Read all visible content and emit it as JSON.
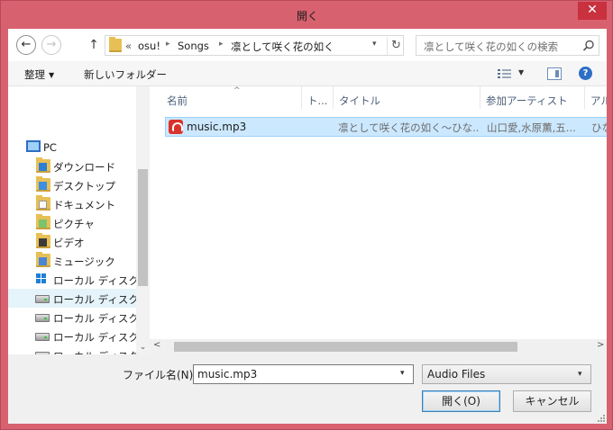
{
  "window": {
    "title": "開く",
    "close_glyph": "✕"
  },
  "address": {
    "back_glyph": "←",
    "forward_glyph": "→",
    "up_glyph": "↑",
    "prefix": "«",
    "segments": [
      "osu!",
      "Songs",
      "凛として咲く花の如く"
    ],
    "separator": "▸",
    "dropdown_glyph": "▾",
    "refresh_glyph": "↻"
  },
  "search": {
    "placeholder": "凛として咲く花の如くの検索",
    "icon": "search-icon"
  },
  "toolbar": {
    "organize_label": "整理",
    "new_folder_label": "新しいフォルダー",
    "caret": "▼"
  },
  "nav": {
    "items": [
      {
        "label": "PC",
        "icon": "pc-icon"
      },
      {
        "label": "ダウンロード",
        "icon": "downloads-folder-icon"
      },
      {
        "label": "デスクトップ",
        "icon": "desktop-folder-icon"
      },
      {
        "label": "ドキュメント",
        "icon": "documents-folder-icon"
      },
      {
        "label": "ピクチャ",
        "icon": "pictures-folder-icon"
      },
      {
        "label": "ビデオ",
        "icon": "videos-folder-icon"
      },
      {
        "label": "ミュージック",
        "icon": "music-folder-icon"
      },
      {
        "label": "ローカル ディスク (C",
        "icon": "system-drive-icon"
      },
      {
        "label": "ローカル ディスク (D",
        "icon": "drive-icon",
        "selected": true
      },
      {
        "label": "ローカル ディスク (E",
        "icon": "drive-icon"
      },
      {
        "label": "ローカル ディスク (F",
        "icon": "drive-icon"
      },
      {
        "label": "ローカル ディスク (G",
        "icon": "drive-icon"
      }
    ],
    "scroll_down_glyph": "⌄"
  },
  "columns": [
    "名前",
    "ト...",
    "タイトル",
    "参加アーティスト",
    "アルバ"
  ],
  "sort_glyph": "^",
  "files": [
    {
      "name": "music.mp3",
      "title": "凛として咲く花の如く〜ひな...",
      "artists": "山口愛,水原薫,五...",
      "album": "ひな",
      "icon": "audio-file-icon"
    }
  ],
  "hscroll": {
    "left_glyph": "<",
    "right_glyph": ">"
  },
  "footer": {
    "filename_label": "ファイル名(N):",
    "filename_value": "music.mp3",
    "dropdown_glyph": "▾",
    "filetype_value": "Audio Files",
    "open_label": "開く(O)",
    "cancel_label": "キャンセル"
  },
  "colors": {
    "titlebar": "#d8616f",
    "close": "#c9313f",
    "selection": "#cce8ff",
    "selection_border": "#99d1ff"
  }
}
